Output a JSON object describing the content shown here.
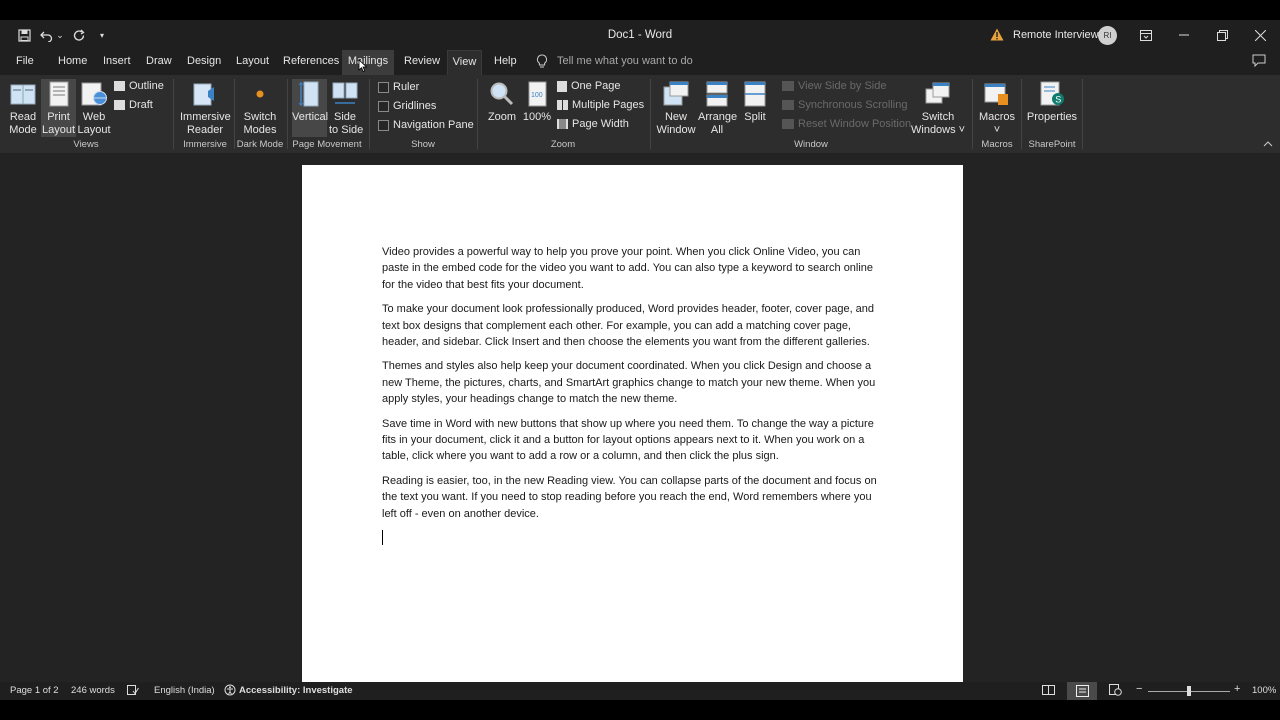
{
  "titlebar": {
    "doc_title": "Doc1  -  Word",
    "user_name": "Remote Interview",
    "user_initials": "RI"
  },
  "tabs": [
    {
      "label": "File",
      "state": "normal"
    },
    {
      "label": "Home",
      "state": "normal"
    },
    {
      "label": "Insert",
      "state": "normal"
    },
    {
      "label": "Draw",
      "state": "normal"
    },
    {
      "label": "Design",
      "state": "normal"
    },
    {
      "label": "Layout",
      "state": "normal"
    },
    {
      "label": "References",
      "state": "normal"
    },
    {
      "label": "Mailings",
      "state": "hover"
    },
    {
      "label": "Review",
      "state": "normal"
    },
    {
      "label": "View",
      "state": "selected"
    },
    {
      "label": "Help",
      "state": "normal"
    }
  ],
  "tell_me": "Tell me what you want to do",
  "ribbon": {
    "views": {
      "read_mode": "Read\nMode",
      "print_layout": "Print\nLayout",
      "web_layout": "Web\nLayout",
      "outline": "Outline",
      "draft": "Draft",
      "group": "Views"
    },
    "immersive": {
      "reader": "Immersive\nReader",
      "group": "Immersive"
    },
    "dark_mode": {
      "switch_modes": "Switch\nModes",
      "group": "Dark Mode"
    },
    "page_movement": {
      "vertical": "Vertical",
      "side_to_side": "Side\nto Side",
      "group": "Page Movement"
    },
    "show": {
      "ruler": "Ruler",
      "gridlines": "Gridlines",
      "navigation_pane": "Navigation Pane",
      "group": "Show"
    },
    "zoom": {
      "zoom": "Zoom",
      "hundred": "100%",
      "one_page": "One Page",
      "multiple_pages": "Multiple Pages",
      "page_width": "Page Width",
      "group": "Zoom"
    },
    "window": {
      "new_window": "New\nWindow",
      "arrange_all": "Arrange\nAll",
      "split": "Split",
      "view_side_by_side": "View Side by Side",
      "synchronous_scrolling": "Synchronous Scrolling",
      "reset_window_position": "Reset Window Position",
      "switch_windows": "Switch\nWindows ˅",
      "group": "Window"
    },
    "macros": {
      "macros": "Macros\n˅",
      "group": "Macros"
    },
    "sharepoint": {
      "properties": "Properties",
      "group": "SharePoint"
    }
  },
  "document": {
    "paragraphs": [
      "Video provides a powerful way to help you prove your point. When you click Online Video, you can paste in the embed code for the video you want to add. You can also type a keyword to search online for the video that best fits your document.",
      "To make your document look professionally produced, Word provides header, footer, cover page, and text box designs that complement each other. For example, you can add a matching cover page, header, and sidebar. Click Insert and then choose the elements you want from the different galleries.",
      "Themes and styles also help keep your document coordinated. When you click Design and choose a new Theme, the pictures, charts, and SmartArt graphics change to match your new theme. When you apply styles, your headings change to match the new theme.",
      "Save time in Word with new buttons that show up where you need them. To change the way a picture fits in your document, click it and a button for layout options appears next to it. When you work on a table, click where you want to add a row or a column, and then click the plus sign.",
      "Reading is easier, too, in the new Reading view. You can collapse parts of the document and focus on the text you want. If you need to stop reading before you reach the end, Word remembers where you left off - even on another device."
    ]
  },
  "status": {
    "page": "Page 1 of 2",
    "words": "246 words",
    "language": "English (India)",
    "accessibility": "Accessibility: Investigate",
    "zoom": "100%"
  }
}
